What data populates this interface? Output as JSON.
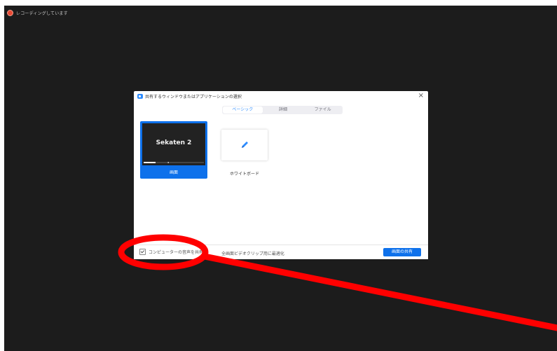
{
  "recording": {
    "label": "レコーディングしています"
  },
  "dialog": {
    "title": "共有するウィンドウまたはアプリケーションの選択",
    "close_symbol": "×",
    "tabs": [
      {
        "label": "ベーシック",
        "active": true
      },
      {
        "label": "詳細",
        "active": false
      },
      {
        "label": "ファイル",
        "active": false
      }
    ],
    "options": {
      "screen": {
        "thumbnail_title": "Sekaten 2",
        "label": "画面",
        "selected": true
      },
      "whiteboard": {
        "label": "ホワイトボード",
        "icon": "pencil-icon"
      }
    },
    "footer": {
      "checkbox_label": "コンピューターの音声を共有",
      "checkbox_checked": true,
      "secondary_text": "全画面ビデオクリップ用に最適化",
      "share_button_label": "画面の共有"
    }
  },
  "colors": {
    "background": "#1c1c1c",
    "accent": "#0e71eb",
    "annotation": "#ff0000"
  }
}
